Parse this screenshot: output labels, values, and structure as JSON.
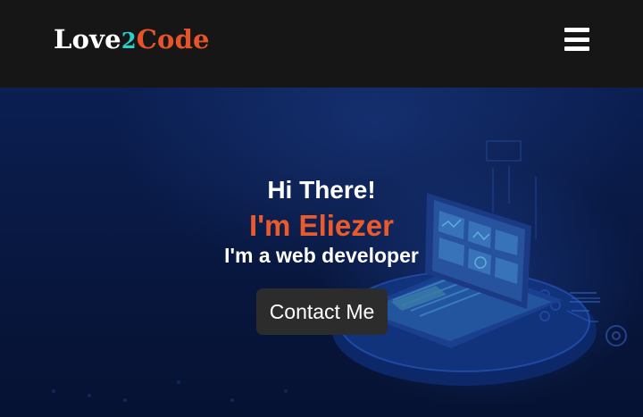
{
  "navbar": {
    "logo": {
      "part1": "Love",
      "part2": "2",
      "part3": "Code"
    },
    "menu_icon": "hamburger-menu-icon"
  },
  "hero": {
    "greeting": "Hi There!",
    "name": "I'm Eliezer",
    "role": "I'm a web developer",
    "contact_button": "Contact Me",
    "background_image": "laptop-isometric-illustration"
  },
  "colors": {
    "navbar_bg": "#161616",
    "accent_orange": "#ea5a2b",
    "accent_teal": "#2ad1c9",
    "hero_bg": "#0b1f52",
    "button_bg": "#2c2c2c"
  }
}
